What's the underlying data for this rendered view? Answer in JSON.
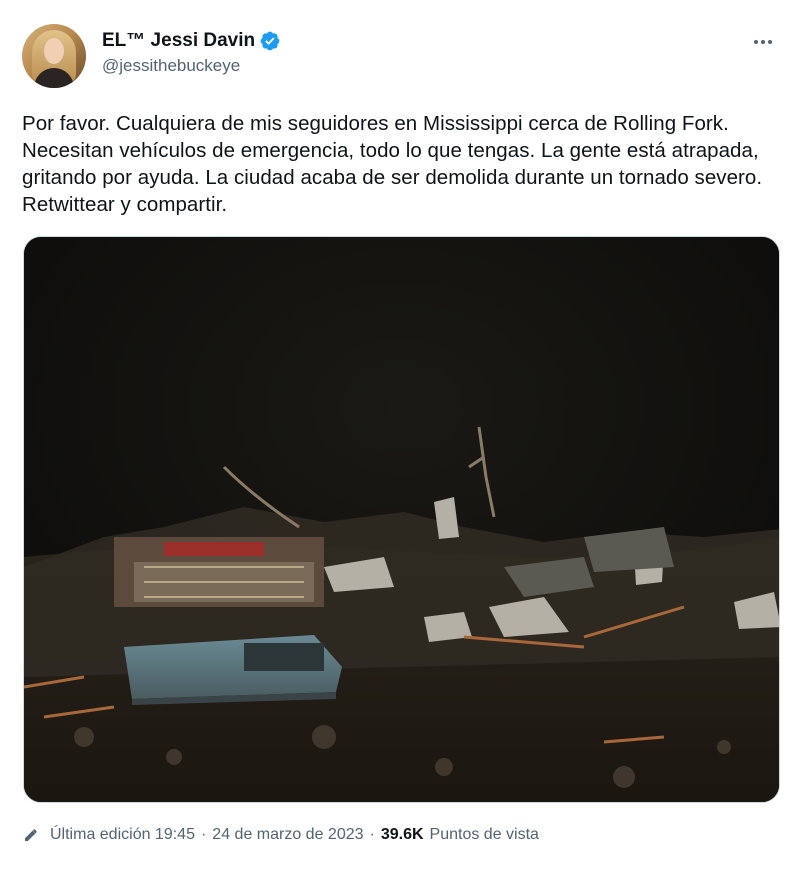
{
  "author": {
    "display_name": "EL™ Jessi Davin",
    "handle": "@jessithebuckeye",
    "verified": true,
    "avatar_icon": "user-avatar"
  },
  "tweet": {
    "text": "Por favor. Cualquiera de mis seguidores en Mississippi cerca de Rolling Fork. Necesitan vehículos de emergencia, todo lo que tengas. La gente está atrapada, gritando por ayuda. La ciudad acaba de ser demolida durante un tornado severo. Retwittear y compartir.",
    "media_icon": "tornado-debris-photo"
  },
  "meta": {
    "edited_label": "Última edición 19:45",
    "date": "24 de marzo de 2023",
    "views_count": "39.6K",
    "views_label": "Puntos de vista",
    "separator": "·"
  },
  "colors": {
    "text": "#0f1419",
    "secondary": "#536471",
    "verified_blue": "#1d9bf0",
    "border": "#cfd9de"
  }
}
